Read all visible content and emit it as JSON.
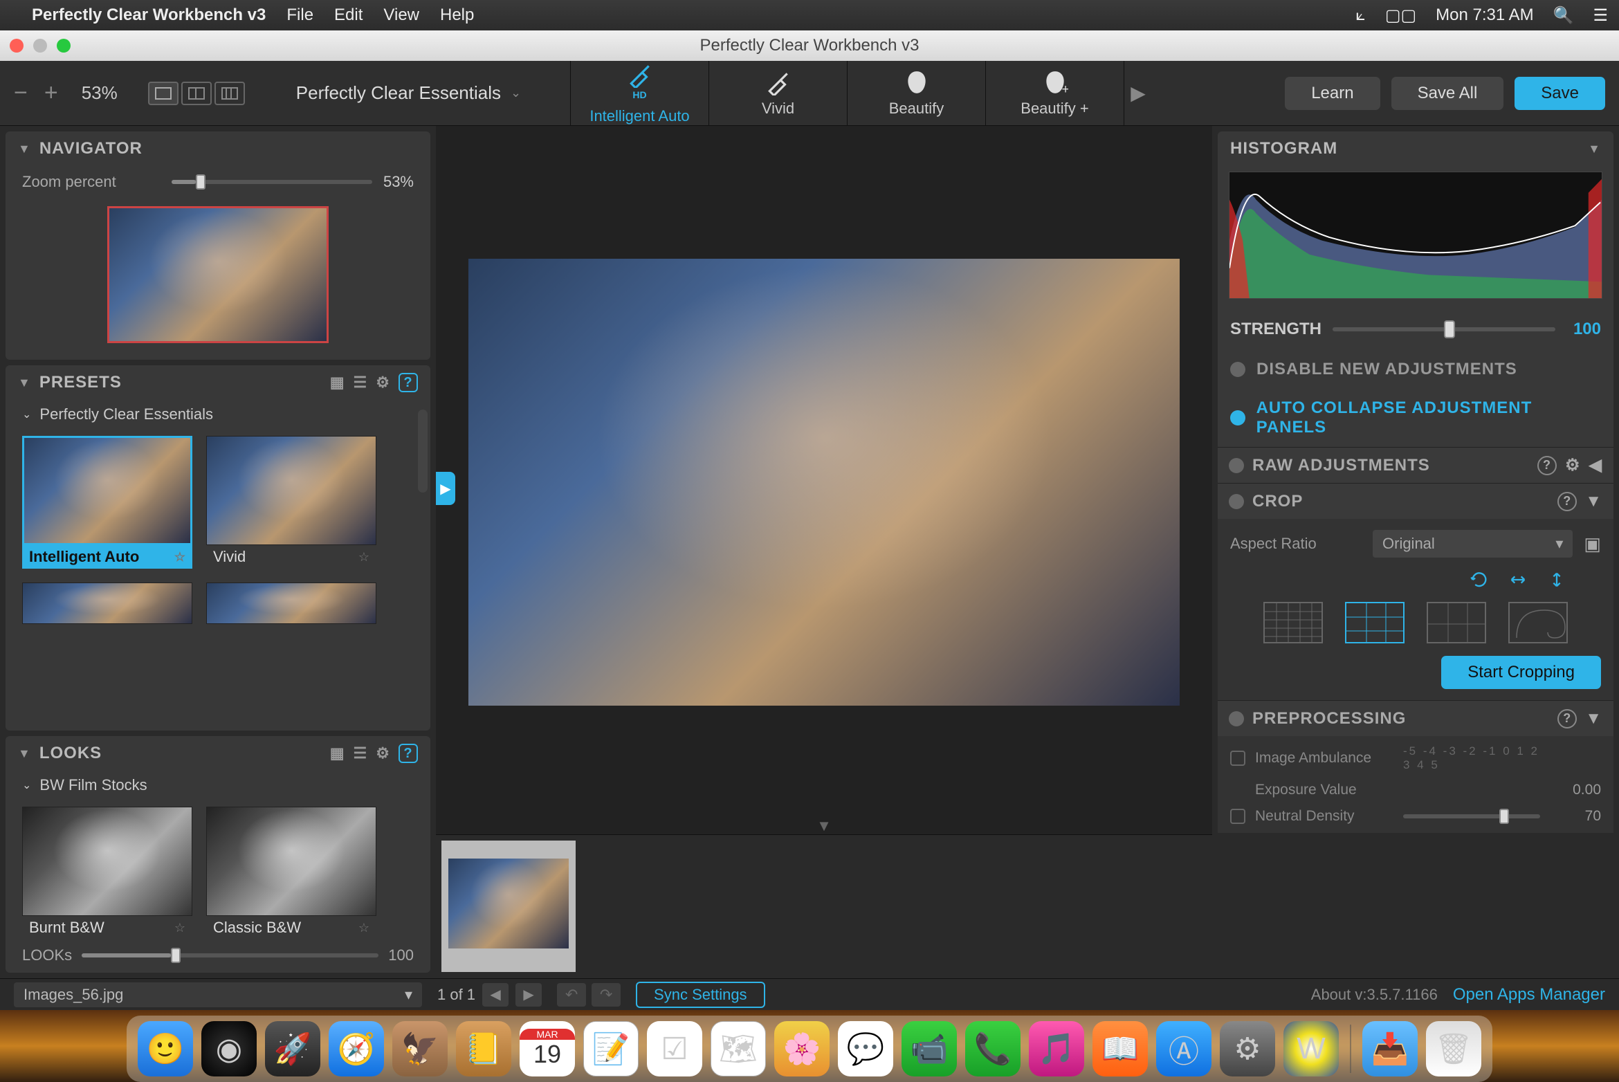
{
  "menubar": {
    "app_name": "Perfectly Clear Workbench v3",
    "menus": [
      "File",
      "Edit",
      "View",
      "Help"
    ],
    "clock": "Mon 7:31 AM"
  },
  "window": {
    "title": "Perfectly Clear Workbench v3"
  },
  "toolbar": {
    "zoom_percent": "53%",
    "preset_dropdown": "Perfectly Clear Essentials",
    "tabs": [
      {
        "label": "Intelligent Auto",
        "hd": "HD",
        "active": true
      },
      {
        "label": "Vivid",
        "active": false
      },
      {
        "label": "Beautify",
        "active": false
      },
      {
        "label": "Beautify +",
        "active": false
      }
    ],
    "learn": "Learn",
    "save_all": "Save All",
    "save": "Save"
  },
  "navigator": {
    "title": "NAVIGATOR",
    "zoom_label": "Zoom percent",
    "zoom_value": "53%",
    "slider_pct": 12
  },
  "presets": {
    "title": "PRESETS",
    "group": "Perfectly Clear Essentials",
    "items": [
      {
        "label": "Intelligent Auto",
        "active": true
      },
      {
        "label": "Vivid",
        "active": false
      }
    ]
  },
  "looks": {
    "title": "LOOKS",
    "group": "BW Film Stocks",
    "items": [
      {
        "label": "Burnt B&W"
      },
      {
        "label": "Classic B&W"
      }
    ],
    "slider_label": "LOOKs",
    "slider_value": "100",
    "slider_pct": 30
  },
  "right": {
    "histogram_title": "HISTOGRAM",
    "strength_label": "STRENGTH",
    "strength_value": "100",
    "strength_pct": 50,
    "disable_new": "DISABLE NEW ADJUSTMENTS",
    "auto_collapse": "AUTO COLLAPSE ADJUSTMENT PANELS",
    "raw_title": "RAW ADJUSTMENTS",
    "crop": {
      "title": "CROP",
      "aspect_label": "Aspect Ratio",
      "aspect_value": "Original",
      "start": "Start Cropping"
    },
    "preproc": {
      "title": "PREPROCESSING",
      "rows": [
        {
          "label": "Image Ambulance",
          "ticks": "-5 -4 -3 -2 -1 0 1 2 3 4 5",
          "value": ""
        },
        {
          "label": "Exposure Value",
          "ticks": "",
          "value": "0.00"
        },
        {
          "label": "Neutral Density",
          "ticks": "",
          "value": "70"
        }
      ]
    }
  },
  "status": {
    "filename": "Images_56.jpg",
    "pager": "1 of 1",
    "sync": "Sync Settings",
    "about": "About v:3.5.7.1166",
    "open_apps": "Open Apps Manager"
  },
  "dock": {
    "cal_month": "MAR",
    "cal_day": "19"
  }
}
